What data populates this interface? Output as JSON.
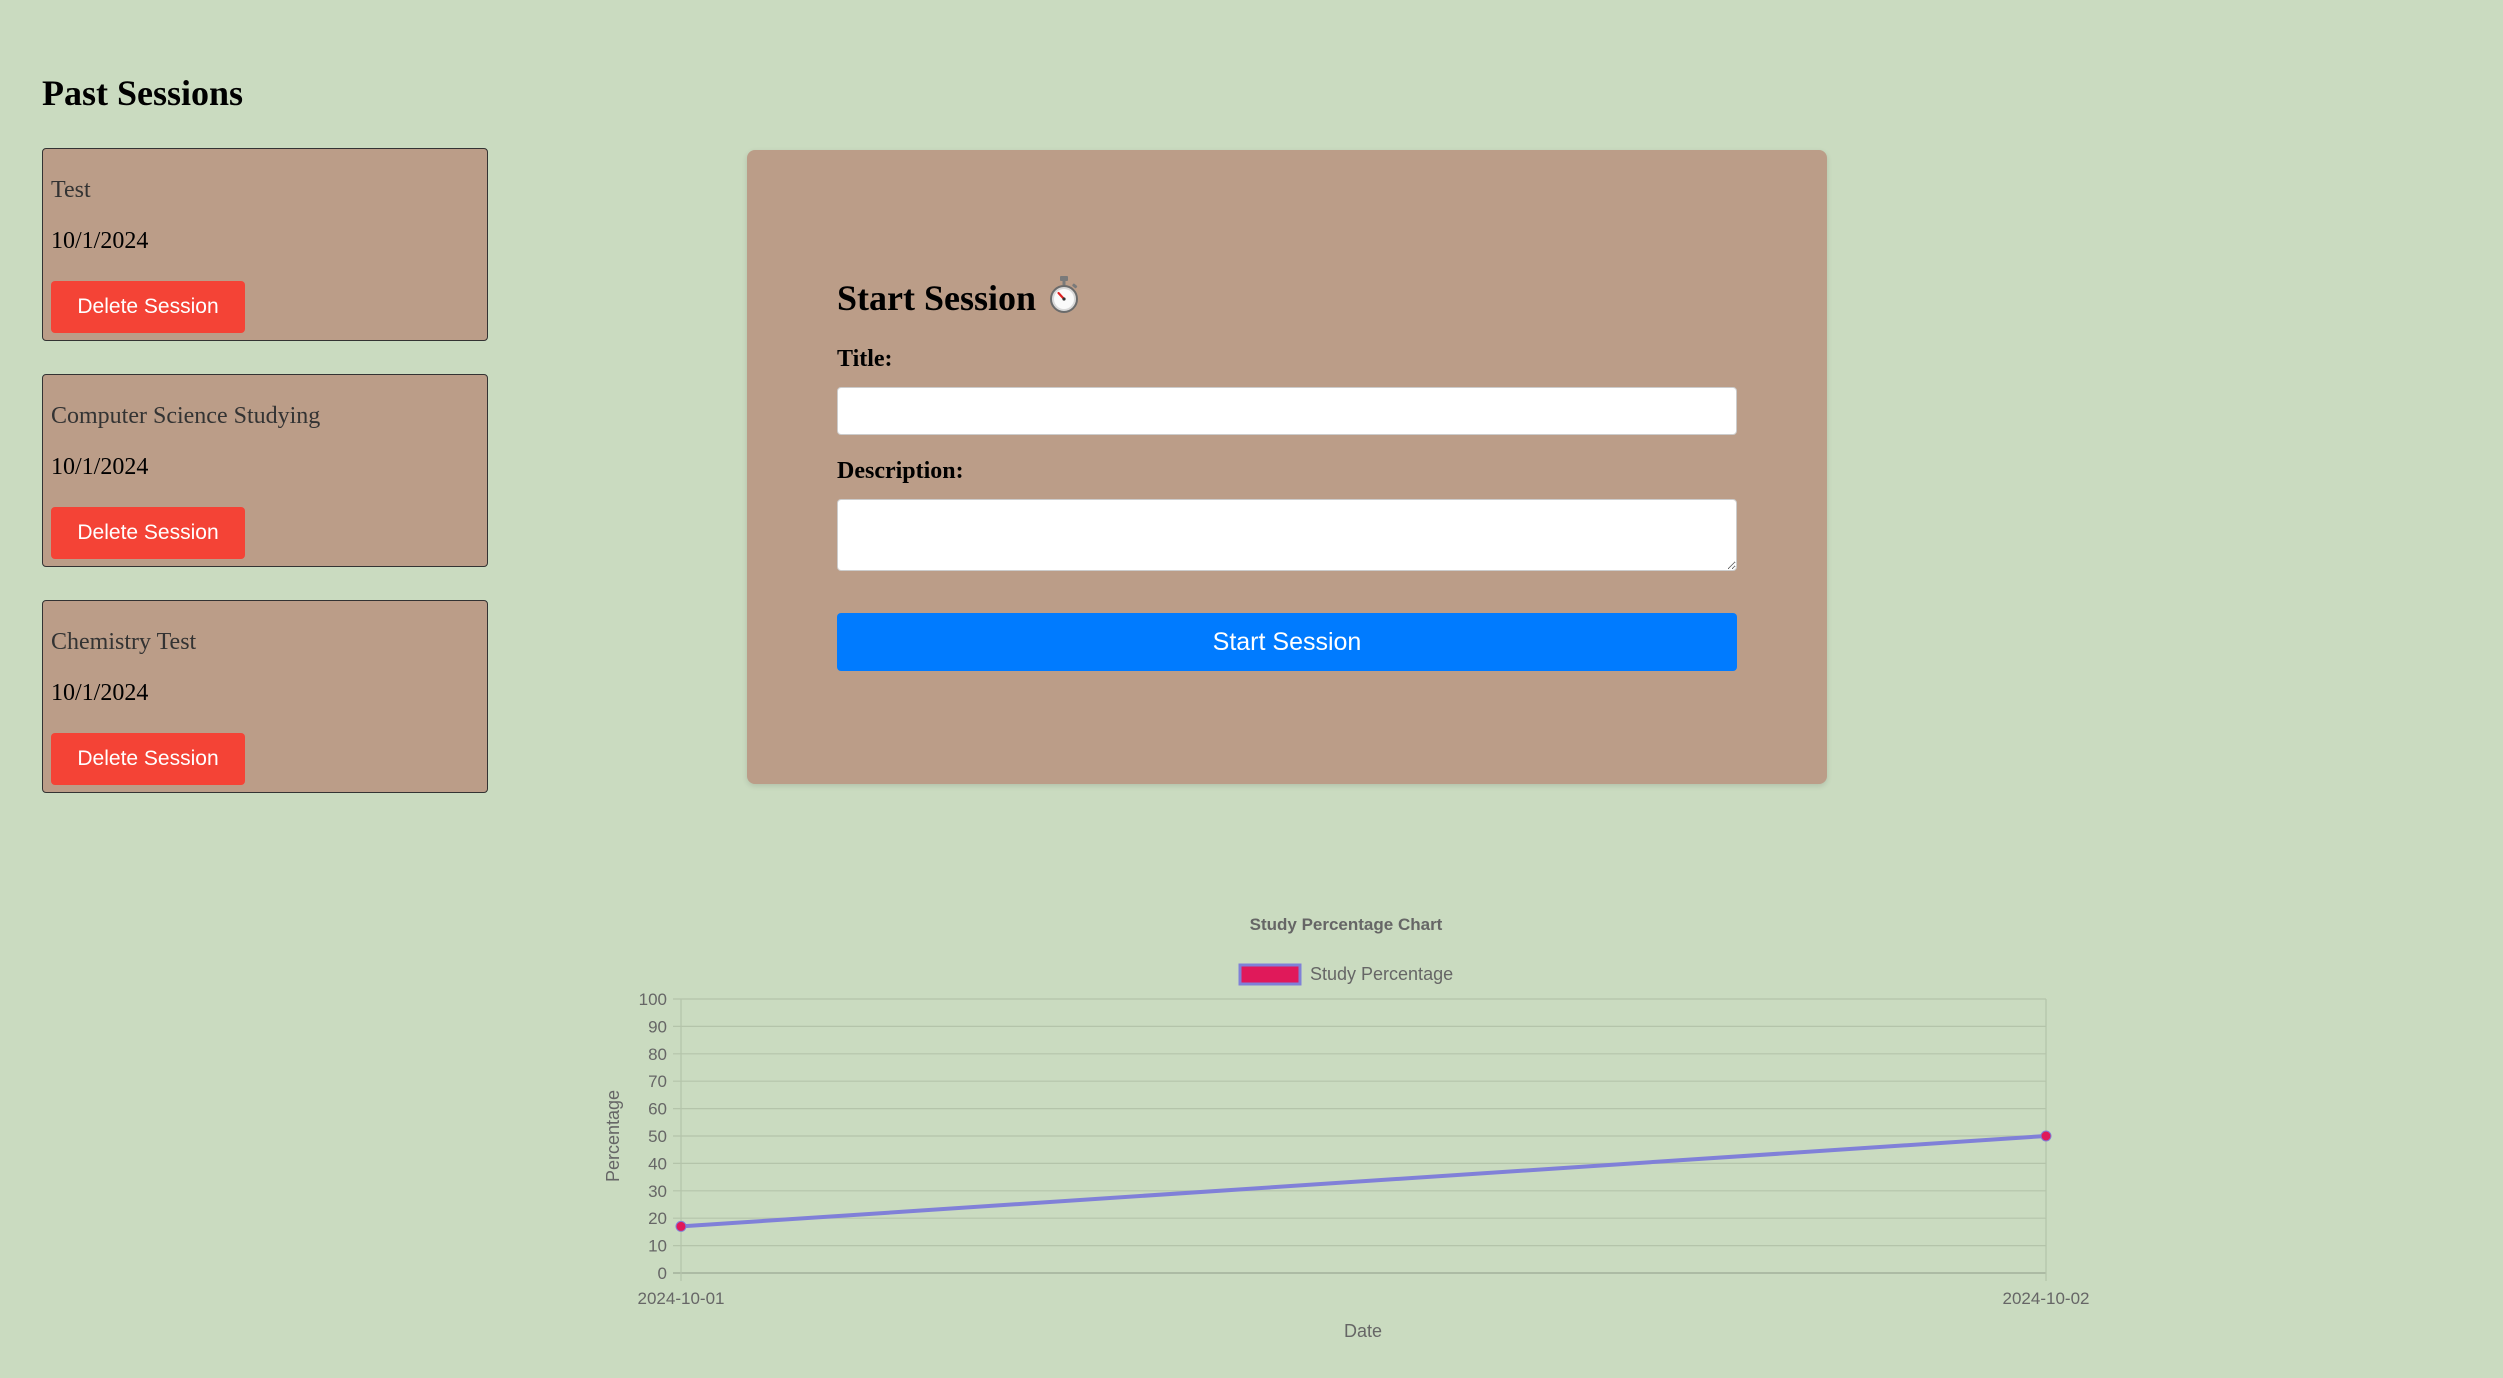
{
  "past_sessions": {
    "heading": "Past Sessions",
    "sessions": [
      {
        "title": "Test",
        "date": "10/1/2024",
        "delete_label": "Delete Session"
      },
      {
        "title": "Computer Science Studying",
        "date": "10/1/2024",
        "delete_label": "Delete Session"
      },
      {
        "title": "Chemistry Test",
        "date": "10/1/2024",
        "delete_label": "Delete Session"
      }
    ]
  },
  "start_form": {
    "heading": "Start Session",
    "heading_icon": "stopwatch-icon",
    "title_label": "Title:",
    "title_value": "",
    "description_label": "Description:",
    "description_value": "",
    "button_label": "Start Session"
  },
  "colors": {
    "page_background": "#cadbc0",
    "card_background": "#bb9d88",
    "delete_button": "#f44336",
    "start_button": "#007bff",
    "line_color": "#8080d8",
    "point_color": "#e0195a"
  },
  "chart_data": {
    "type": "line",
    "title": "Study Percentage Chart",
    "xlabel": "Date",
    "ylabel": "Percentage",
    "x": [
      "2024-10-01",
      "2024-10-02"
    ],
    "series": [
      {
        "name": "Study Percentage",
        "values": [
          17,
          50
        ]
      }
    ],
    "ylim": [
      0,
      100
    ],
    "yticks": [
      0,
      10,
      20,
      30,
      40,
      50,
      60,
      70,
      80,
      90,
      100
    ],
    "grid": true,
    "legend_position": "top"
  }
}
